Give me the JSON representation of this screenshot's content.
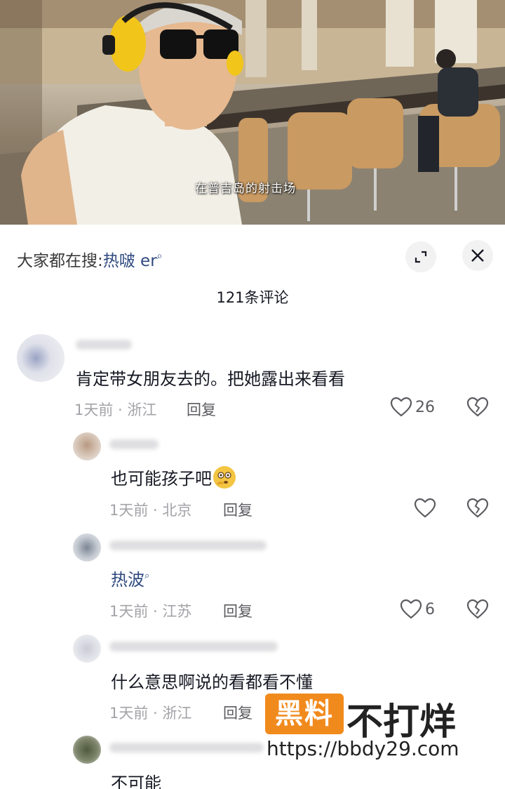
{
  "video": {
    "subtitle": "在普吉岛的射击场"
  },
  "search": {
    "prefix": "大家都在搜:",
    "term": "热啵 er",
    "search_icon": "search-small-icon",
    "expand_icon": "expand-icon",
    "close_icon": "close-icon"
  },
  "comments_header": {
    "count_label": "121条评论"
  },
  "comments": [
    {
      "text": "肯定带女朋友去的。把她露出来看看",
      "meta": "1天前 · 浙江",
      "reply_label": "回复",
      "likes": "26",
      "level": "top"
    },
    {
      "text": "也可能孩子吧",
      "emoji": "thinking-face-emoji",
      "meta": "1天前 · 北京",
      "reply_label": "回复",
      "likes": "",
      "level": "reply"
    },
    {
      "text": "热波",
      "is_search_link": true,
      "meta": "1天前 · 江苏",
      "reply_label": "回复",
      "likes": "6",
      "level": "reply"
    },
    {
      "text": "什么意思啊说的看都看不懂",
      "meta": "1天前 · 浙江",
      "reply_label": "回复",
      "likes": "",
      "level": "reply"
    },
    {
      "text": "不可能",
      "meta": "",
      "reply_label": "",
      "likes": "",
      "level": "reply"
    }
  ],
  "watermark": {
    "badge": "黑料",
    "title": "不打烊",
    "url": "https://bbdy29.com"
  },
  "colors": {
    "link_blue": "#2f4a80",
    "meta_gray": "#a3a3a8",
    "watermark_orange": "#f18a1c"
  }
}
